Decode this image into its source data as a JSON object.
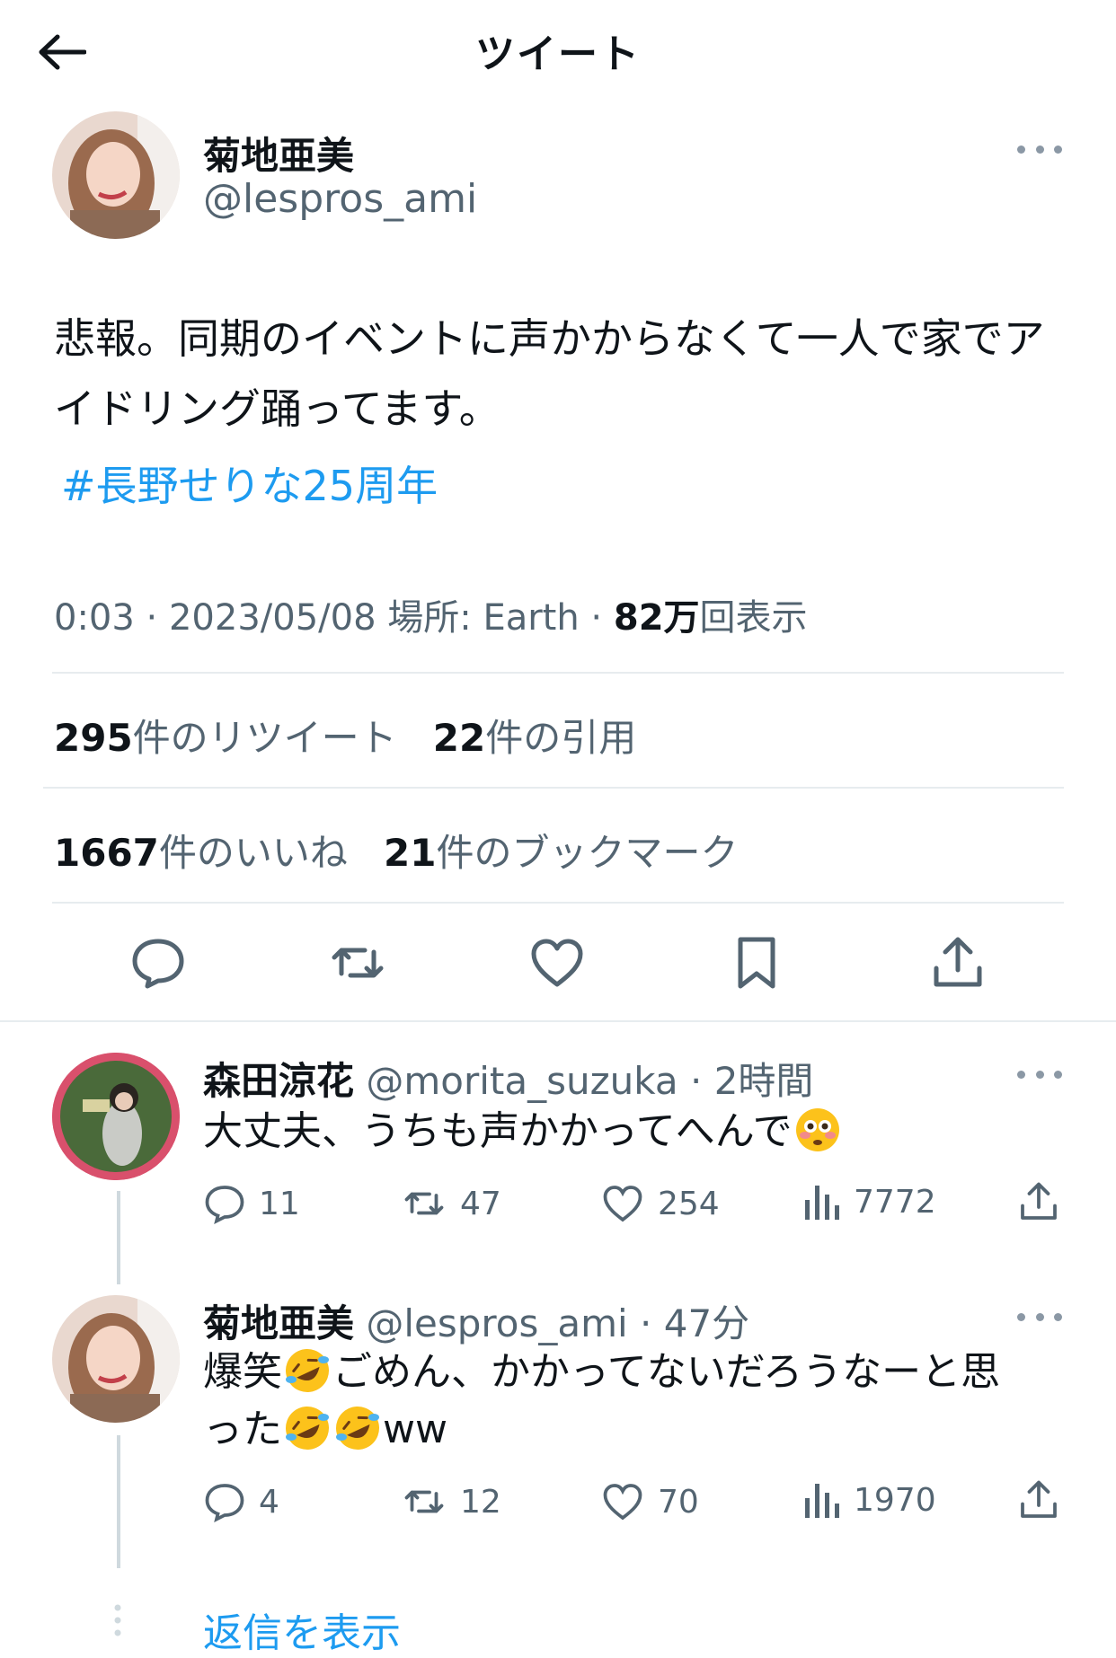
{
  "header": {
    "title": "ツイート"
  },
  "tweet": {
    "author_name": "菊地亜美",
    "author_handle": "@lespros_ami",
    "text": "悲報。同期のイベントに声かからなくて一人で家でアイドリング踊ってます。",
    "hashtag": "#長野せりな25周年",
    "time": "0:03",
    "date": "2023/05/08",
    "location_label": "場所: Earth",
    "views_count": "82万",
    "views_label": "回表示",
    "retweets_count": "295",
    "retweets_label": "件のリツイート",
    "quotes_count": "22",
    "quotes_label": "件の引用",
    "likes_count": "1667",
    "likes_label": "件のいいね",
    "bookmarks_count": "21",
    "bookmarks_label": "件のブックマーク"
  },
  "replies": [
    {
      "author_name": "森田涼花",
      "author_handle": "@morita_suzuka",
      "time": "2時間",
      "text": "大丈夫、うちも声かかってへんで",
      "emoji": "flushed-face",
      "reply_count": "11",
      "retweet_count": "47",
      "like_count": "254",
      "view_count": "7772"
    },
    {
      "author_name": "菊地亜美",
      "author_handle": "@lespros_ami",
      "time": "47分",
      "text_part1": "爆笑",
      "text_part2": "ごめん、かかってないだろうなーと思",
      "text_part3": "った",
      "text_part4": "ww",
      "emoji": "rolling-on-floor-laughing",
      "reply_count": "4",
      "retweet_count": "12",
      "like_count": "70",
      "view_count": "1970"
    }
  ],
  "show_replies_label": "返信を表示",
  "colors": {
    "link": "#1d9bf0",
    "secondary": "#536471",
    "divider": "#e7ecef"
  }
}
